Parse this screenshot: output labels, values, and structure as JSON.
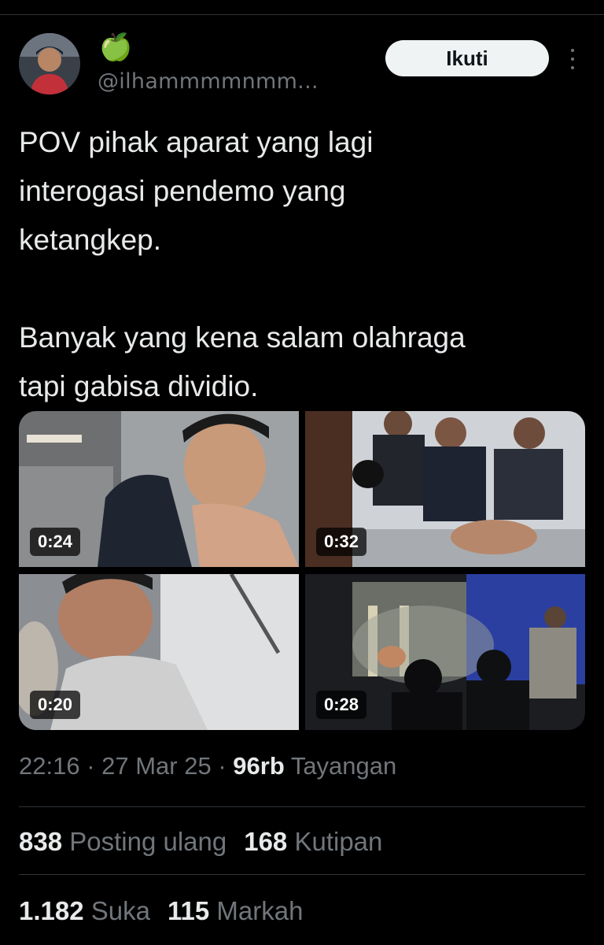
{
  "author": {
    "display_name": "🍏",
    "handle": "@ilhammmmnmm..."
  },
  "follow_button_label": "Ikuti",
  "more_icon": "more-vertical-icon",
  "tweet": {
    "paragraph_1": "POV pihak aparat yang lagi\ninterogasi pendemo yang\nketangkep.",
    "paragraph_2": "Banyak yang kena salam olahraga\ntapi gabisa dividio."
  },
  "media": [
    {
      "duration": "0:24"
    },
    {
      "duration": "0:32"
    },
    {
      "duration": "0:20"
    },
    {
      "duration": "0:28"
    }
  ],
  "meta": {
    "time": "22:16",
    "separator": " · ",
    "date": "27 Mar 25",
    "views_count": "96rb",
    "views_label": " Tayangan"
  },
  "stats": {
    "reposts_count": "838",
    "reposts_label": " Posting ulang",
    "quotes_count": "168",
    "quotes_label": " Kutipan",
    "likes_count": "1.182",
    "likes_label": " Suka",
    "bookmarks_count": "115",
    "bookmarks_label": " Markah"
  },
  "colors": {
    "background": "#000000",
    "text_primary": "#e7e9ea",
    "text_secondary": "#71767b",
    "divider": "#2f3336",
    "follow_button_bg": "#eff3f4"
  }
}
